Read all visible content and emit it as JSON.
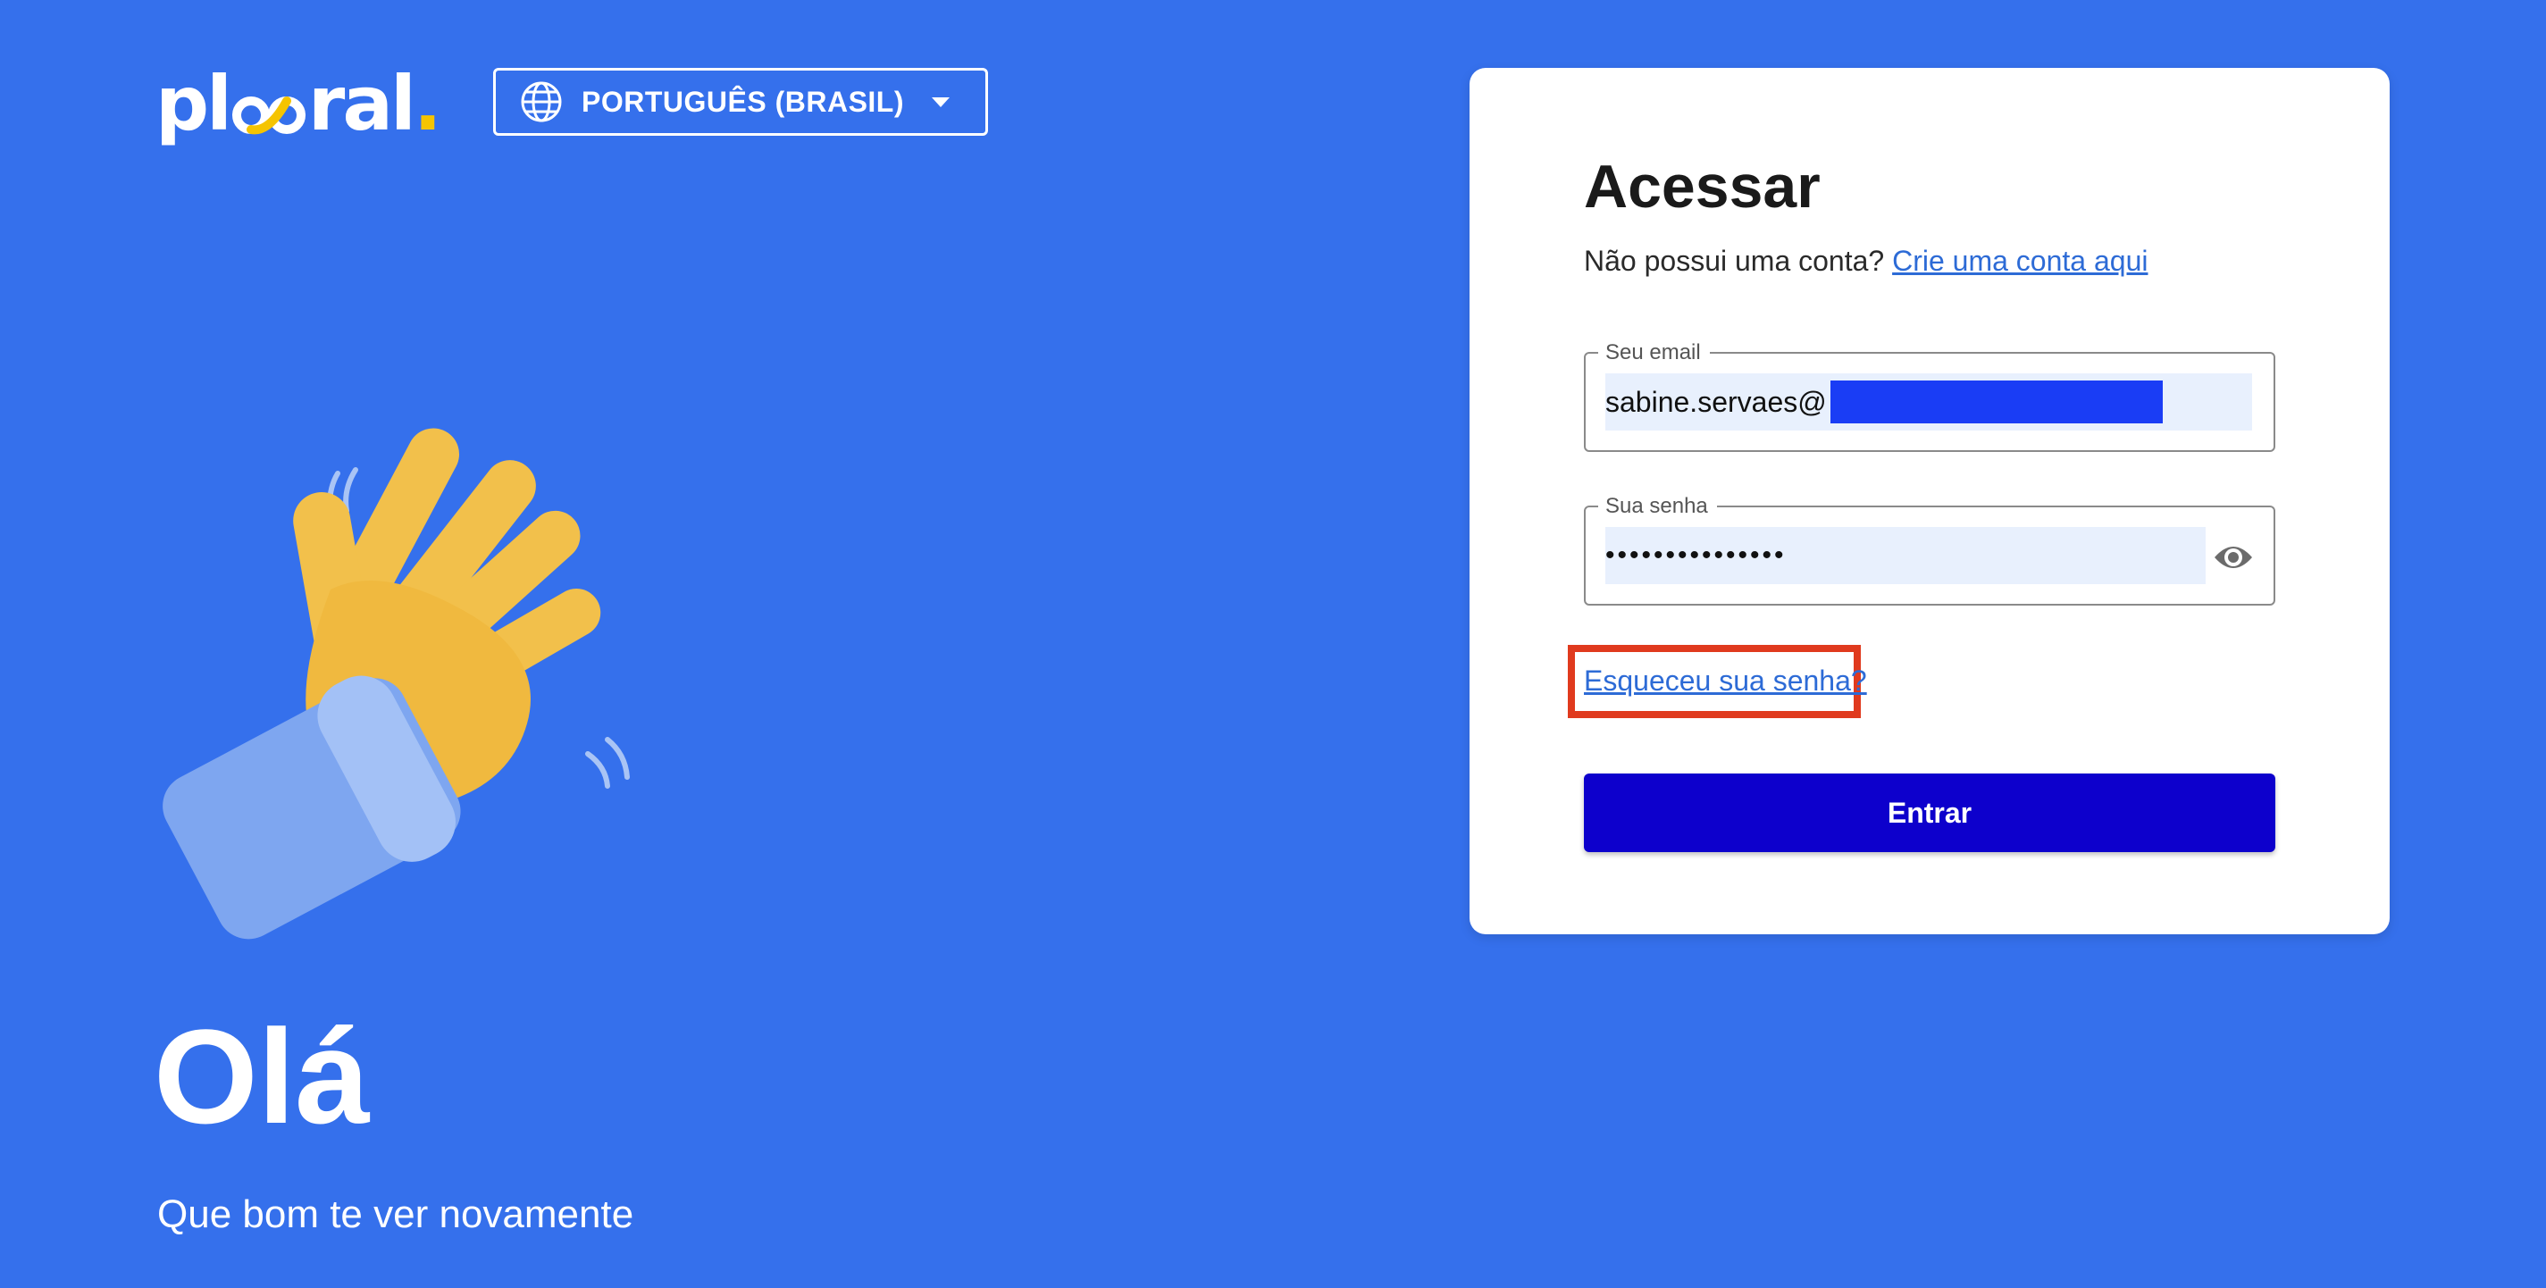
{
  "brand": {
    "logo_text_left": "pl",
    "logo_text_right": "ral",
    "logo_dot": ".",
    "accent_color": "#f5c400",
    "background_color": "#3570ec"
  },
  "language_selector": {
    "icon": "globe-icon",
    "selected": "PORTUGUÊS (BRASIL)",
    "caret_icon": "caret-down-icon"
  },
  "hero": {
    "illustration": "waving-hand-icon",
    "greeting": "Olá",
    "subgreeting": "Que bom te ver novamente"
  },
  "login_card": {
    "title": "Acessar",
    "no_account_text": "Não possui uma conta?",
    "signup_link": "Crie uma conta aqui",
    "email_field": {
      "label": "Seu email",
      "value": "sabine.servaes@"
    },
    "password_field": {
      "label": "Sua senha",
      "value": "•••••••••••••••",
      "toggle_icon": "eye-icon"
    },
    "forgot_password_link": "Esqueceu sua senha?",
    "submit_label": "Entrar",
    "submit_color": "#0d00cc",
    "highlight_color": "#e03a1e"
  }
}
